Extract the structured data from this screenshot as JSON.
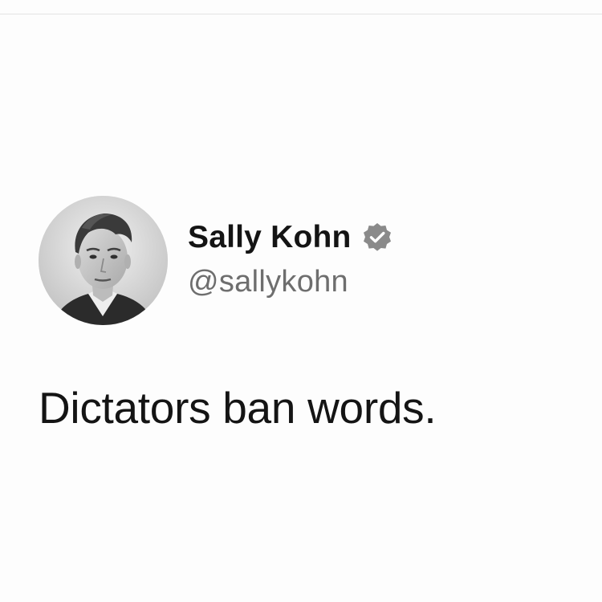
{
  "tweet": {
    "author": {
      "display_name": "Sally Kohn",
      "handle": "@sallykohn",
      "verified": true,
      "avatar_icon": "user-avatar-photo",
      "verified_icon": "verified-badge-icon"
    },
    "text": "Dictators ban words."
  },
  "colors": {
    "background": "#fdfdfd",
    "name_text": "#141414",
    "handle_text": "#6e6e6e",
    "badge": "#8a8a8a"
  }
}
